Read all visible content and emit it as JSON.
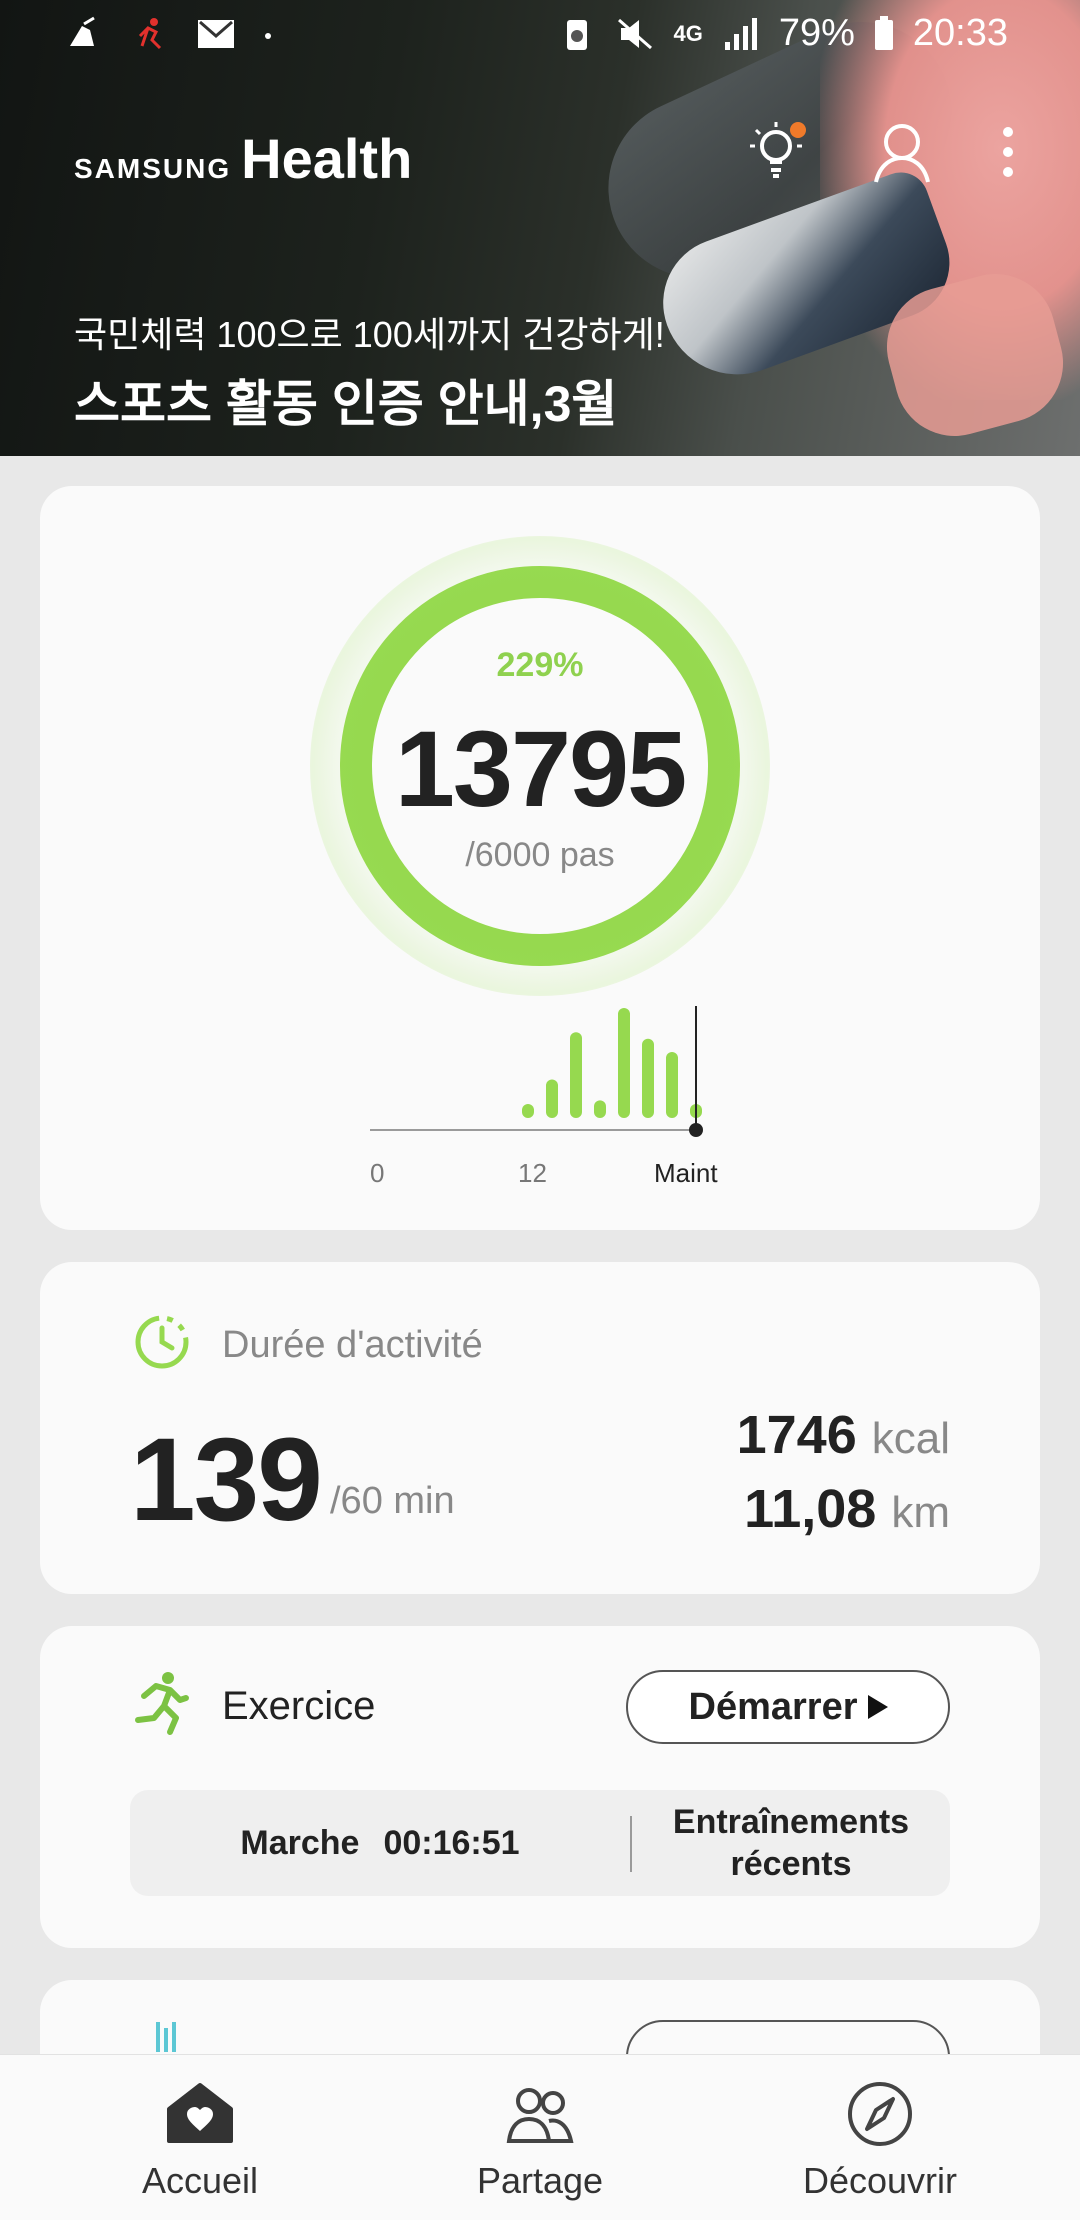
{
  "status_bar": {
    "battery": "79%",
    "time": "20:33",
    "network": "4G",
    "icons": [
      "cleaner-icon",
      "runner-notification-icon",
      "mail-icon",
      "dot-icon",
      "battery-saver-icon",
      "mute-icon",
      "network-4g-icon",
      "signal-icon",
      "battery-icon"
    ]
  },
  "header": {
    "brand_small": "SAMSUNG",
    "brand_large": "Health",
    "icons": [
      "lightbulb-icon",
      "profile-icon",
      "more-vert-icon"
    ],
    "badge_color": "#f07a2a"
  },
  "promo": {
    "subtitle": "국민체력 100으로 100세까지 건강하게!",
    "title": "스포츠 활동 인증 안내,3월"
  },
  "steps_card": {
    "percent": "229%",
    "steps": "13795",
    "goal": "/6000 pas",
    "ring_progress": 1.0,
    "accent_color": "#96d94f",
    "axis_labels": [
      "0",
      "12",
      "Maint"
    ],
    "hourly_bars": [
      0,
      0,
      0,
      0,
      0,
      0,
      0.12,
      0.35,
      0.78,
      0.16,
      1.0,
      0.72,
      0.6,
      0.12
    ]
  },
  "activity_card": {
    "title": "Durée d'activité",
    "minutes": "139",
    "goal": "/60 min",
    "calories_value": "1746",
    "calories_unit": "kcal",
    "distance_value": "11,08",
    "distance_unit": "km"
  },
  "exercise_card": {
    "title": "Exercice",
    "start_label": "Démarrer",
    "last_type": "Marche",
    "last_duration": "00:16:51",
    "recent_label": "Entraînements récents"
  },
  "bottom_nav": {
    "home": "Accueil",
    "share": "Partage",
    "discover": "Découvrir"
  }
}
